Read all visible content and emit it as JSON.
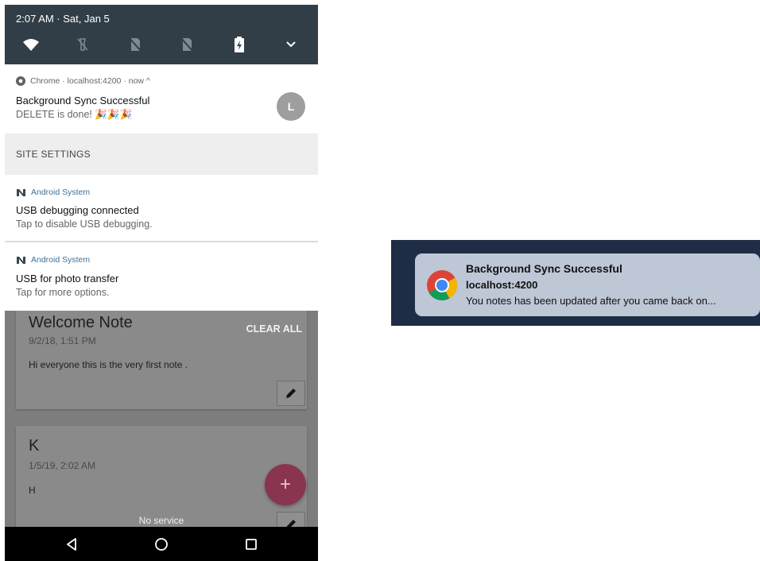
{
  "status_bar": {
    "time": "2:07 AM · Sat, Jan 5",
    "quick_settings": [
      "wifi-icon",
      "flashlight-off-icon",
      "no-sim-icon",
      "no-sim-icon",
      "battery-charging-icon",
      "chevron-down-icon"
    ]
  },
  "notifications": [
    {
      "app": "Chrome · localhost:4200 · now ^",
      "title": "Background Sync Successful",
      "text": "DELETE is done! 🎉🎉🎉",
      "avatar": "L"
    },
    {
      "app": "Android System",
      "title": "USB debugging connected",
      "text": "Tap to disable USB debugging."
    },
    {
      "app": "Android System",
      "title": "USB for photo transfer",
      "text": "Tap for more options."
    }
  ],
  "site_settings": "SITE SETTINGS",
  "app": {
    "clear_all": "CLEAR ALL",
    "notes": [
      {
        "title": "Welcome Note",
        "date": "9/2/18, 1:51 PM",
        "body": "Hi everyone this is the very first note ."
      },
      {
        "title": "K",
        "date": "1/5/19, 2:02 AM",
        "body": "H"
      }
    ],
    "fab": "+",
    "no_service": "No service"
  },
  "desktop_notification": {
    "title": "Background Sync Successful",
    "source": "localhost:4200",
    "body": "You notes has been updated after you came back on..."
  },
  "colors": {
    "status_bar": "#323e47",
    "fab": "#8a3550",
    "desktop_bg": "#1e2d45",
    "toast_bg": "#bec7d6"
  }
}
